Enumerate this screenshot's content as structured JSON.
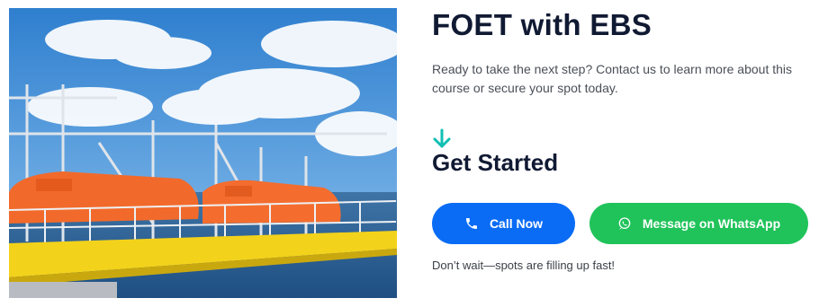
{
  "hero_image": {
    "description": ""
  },
  "course": {
    "title": "FOET with EBS",
    "description": "Ready to take the next step? Contact us to learn more about this course or secure your spot today."
  },
  "cta": {
    "heading": "Get Started",
    "call_label": "Call Now",
    "whatsapp_label": "Message on WhatsApp",
    "note": "Don’t wait—spots are filling up fast!"
  },
  "colors": {
    "accent_arrow": "#10bfb2",
    "call_button": "#0a6cf5",
    "whatsapp_button": "#20c35a",
    "heading": "#111a33"
  },
  "icons": {
    "arrow": "arrow-down-icon",
    "call": "phone-icon",
    "whatsapp": "whatsapp-icon"
  }
}
